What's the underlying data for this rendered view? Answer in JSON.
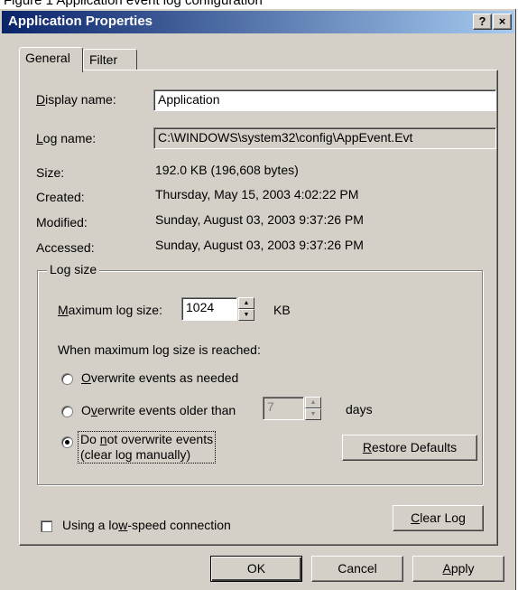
{
  "caption": "Figure 1 Application event log configuration",
  "window": {
    "title": "Application Properties",
    "help_btn": "?",
    "close_btn": "×"
  },
  "tabs": [
    {
      "pre": "",
      "key": "",
      "post": "General",
      "active": true
    },
    {
      "pre": "",
      "key": "",
      "post": "Filter",
      "active": false
    }
  ],
  "general": {
    "display_name": {
      "pre": "",
      "key": "D",
      "post": "isplay name:",
      "value": "Application"
    },
    "log_name": {
      "pre": "",
      "key": "L",
      "post": "og name:",
      "value": "C:\\WINDOWS\\system32\\config\\AppEvent.Evt"
    },
    "size": {
      "label": "Size:",
      "value": "192.0 KB (196,608 bytes)"
    },
    "created": {
      "label": "Created:",
      "value": "Thursday, May 15, 2003 4:02:22 PM"
    },
    "modified": {
      "label": "Modified:",
      "value": "Sunday, August 03, 2003 9:37:26 PM"
    },
    "accessed": {
      "label": "Accessed:",
      "value": "Sunday, August 03, 2003 9:37:26 PM"
    }
  },
  "log_size": {
    "legend": "Log size",
    "max_label": {
      "pre": "",
      "key": "M",
      "post": "aximum log size:"
    },
    "max_value": "1024",
    "unit": "KB",
    "when_text": "When maximum log size is reached:",
    "opt1": {
      "pre": "",
      "key": "O",
      "post": "verwrite events as needed"
    },
    "opt2": {
      "pre": "O",
      "key": "v",
      "post": "erwrite events older than"
    },
    "opt2_days": "7",
    "opt2_unit": "days",
    "opt3": {
      "pre": "Do ",
      "key": "n",
      "post": "ot overwrite events",
      "line2": "(clear log manually)"
    },
    "restore": {
      "pre": "",
      "key": "R",
      "post": "estore Defaults"
    }
  },
  "low_speed": {
    "pre": "Using a lo",
    "key": "w",
    "post": "-speed connection"
  },
  "clear_log": {
    "pre": "",
    "key": "C",
    "post": "lear Log"
  },
  "footer": {
    "ok": "OK",
    "cancel": "Cancel",
    "apply": {
      "pre": "",
      "key": "A",
      "post": "pply"
    }
  }
}
